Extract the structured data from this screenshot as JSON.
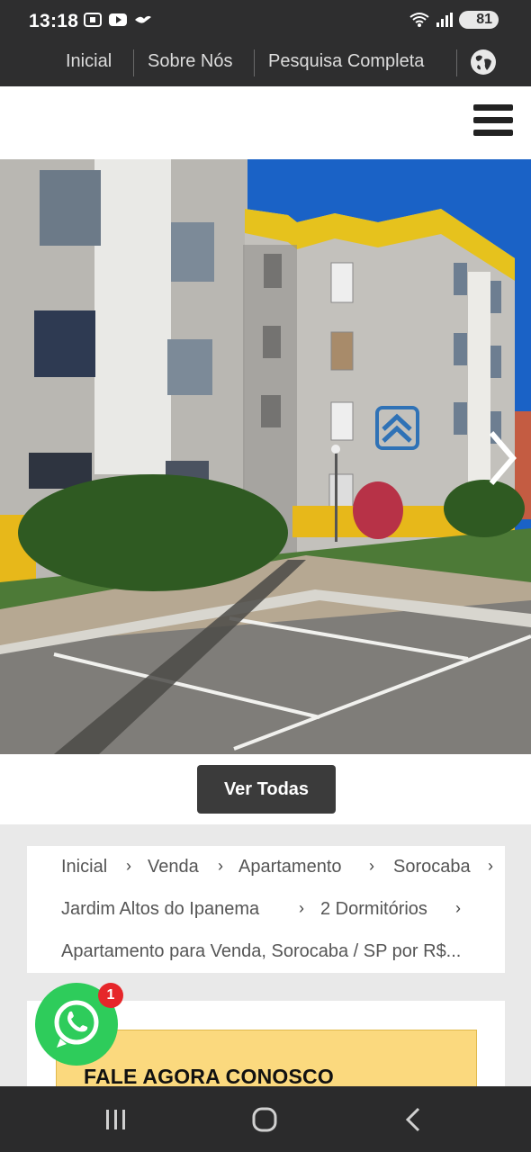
{
  "status_bar": {
    "time": "13:18",
    "battery": "81",
    "icons": [
      "screenshot-icon",
      "youtube-icon",
      "bird-icon",
      "wifi-icon",
      "signal-icon"
    ]
  },
  "top_nav": {
    "items": [
      {
        "label": "Inicial"
      },
      {
        "label": "Sobre Nós"
      },
      {
        "label": "Pesquisa Completa"
      }
    ],
    "globe_icon": "globe-icon"
  },
  "header": {
    "menu_icon": "hamburger-menu-icon"
  },
  "gallery": {
    "logo_icon": "real-estate-logo-icon",
    "next_icon": "chevron-right-icon",
    "view_all_label": "Ver Todas"
  },
  "breadcrumb": {
    "items": [
      {
        "label": "Inicial"
      },
      {
        "label": "Venda"
      },
      {
        "label": "Apartamento"
      },
      {
        "label": "Sorocaba"
      },
      {
        "label": "Jardim Altos do Ipanema"
      },
      {
        "label": "2 Dormitórios"
      },
      {
        "label": "Apartamento para Venda, Sorocaba / SP por R$..."
      }
    ]
  },
  "contact": {
    "title": "FALE AGORA CONOSCO"
  },
  "whatsapp": {
    "badge_count": "1",
    "icon": "whatsapp-icon"
  },
  "system_nav": {
    "icons": [
      "recent-apps-icon",
      "home-icon",
      "back-icon"
    ]
  },
  "colors": {
    "topbar": "#2e2e2f",
    "button": "#3b3b3b",
    "contact_box": "#fbd97e",
    "whatsapp": "#2ecc5b",
    "badge": "#e6262a",
    "sky": "#1a62c6",
    "building_yellow": "#e8c21e"
  }
}
